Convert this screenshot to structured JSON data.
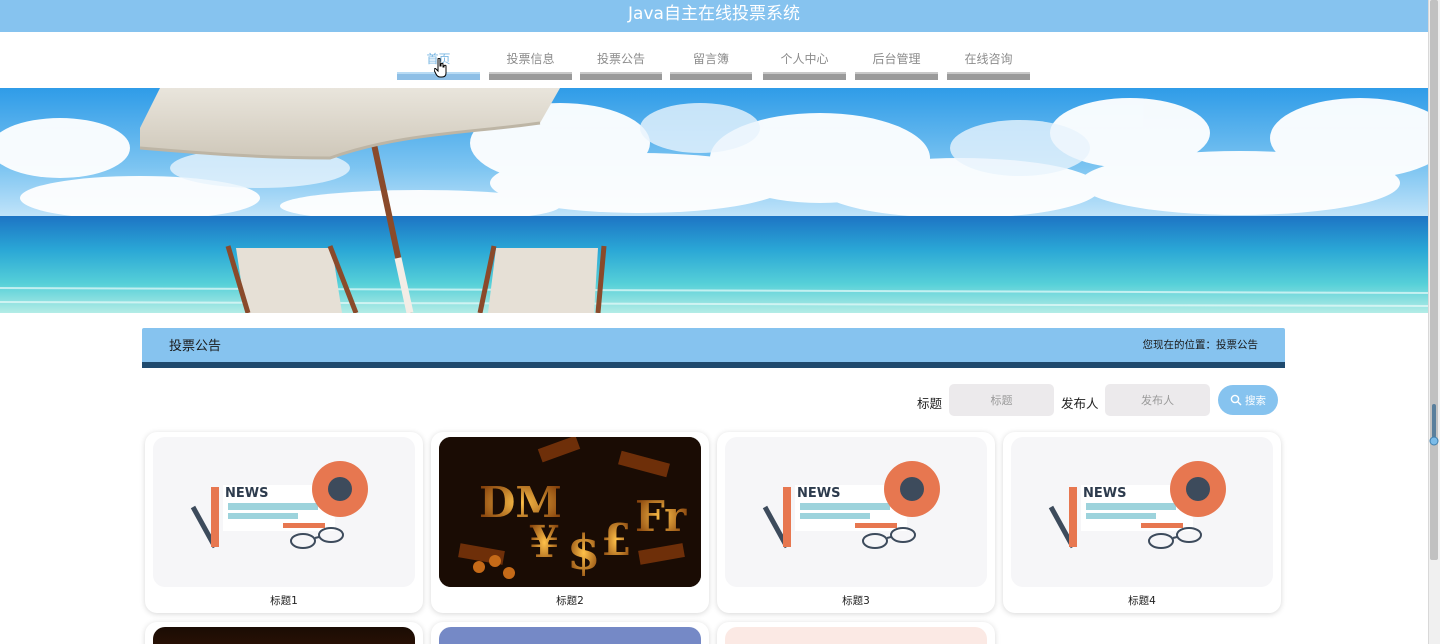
{
  "app": {
    "title": "Java自主在线投票系统"
  },
  "nav": {
    "items": [
      {
        "label": "首页"
      },
      {
        "label": "投票信息"
      },
      {
        "label": "投票公告"
      },
      {
        "label": "留言簿"
      },
      {
        "label": "个人中心"
      },
      {
        "label": "后台管理"
      },
      {
        "label": "在线咨询"
      }
    ]
  },
  "section": {
    "title": "投票公告",
    "breadcrumb": "您现在的位置：投票公告"
  },
  "search": {
    "title_label": "标题",
    "title_placeholder": "标题",
    "publisher_label": "发布人",
    "publisher_placeholder": "发布人",
    "button_label": "搜索",
    "button_icon": "search-icon"
  },
  "cards": [
    {
      "caption": "标题1",
      "image": "news-illustration"
    },
    {
      "caption": "标题2",
      "image": "currency-symbols-photo"
    },
    {
      "caption": "标题3",
      "image": "news-illustration"
    },
    {
      "caption": "标题4",
      "image": "news-illustration"
    }
  ],
  "colors": {
    "accent": "#86c3ef",
    "header_underline": "#1f4a6e",
    "nav_inactive": "#9a9a9a"
  }
}
